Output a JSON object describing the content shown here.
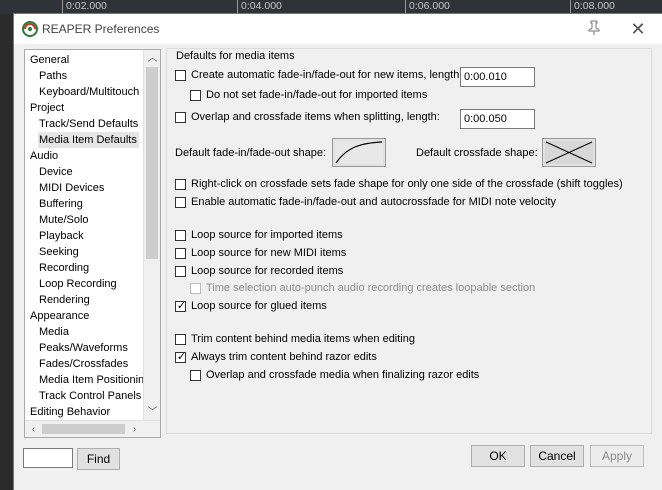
{
  "ruler": {
    "ticks": [
      "0:02.000",
      "0:04.000",
      "0:06.000",
      "0:08.000"
    ]
  },
  "window": {
    "title": "REAPER Preferences"
  },
  "tree": {
    "items": [
      {
        "label": "General",
        "level": 0
      },
      {
        "label": "Paths",
        "level": 1
      },
      {
        "label": "Keyboard/Multitouch",
        "level": 1
      },
      {
        "label": "Project",
        "level": 0
      },
      {
        "label": "Track/Send Defaults",
        "level": 1
      },
      {
        "label": "Media Item Defaults",
        "level": 1,
        "selected": true
      },
      {
        "label": "Audio",
        "level": 0
      },
      {
        "label": "Device",
        "level": 1
      },
      {
        "label": "MIDI Devices",
        "level": 1
      },
      {
        "label": "Buffering",
        "level": 1
      },
      {
        "label": "Mute/Solo",
        "level": 1
      },
      {
        "label": "Playback",
        "level": 1
      },
      {
        "label": "Seeking",
        "level": 1
      },
      {
        "label": "Recording",
        "level": 1
      },
      {
        "label": "Loop Recording",
        "level": 1
      },
      {
        "label": "Rendering",
        "level": 1
      },
      {
        "label": "Appearance",
        "level": 0
      },
      {
        "label": "Media",
        "level": 1
      },
      {
        "label": "Peaks/Waveforms",
        "level": 1
      },
      {
        "label": "Fades/Crossfades",
        "level": 1
      },
      {
        "label": "Media Item Positioning",
        "level": 1
      },
      {
        "label": "Track Control Panels",
        "level": 1
      },
      {
        "label": "Editing Behavior",
        "level": 0
      }
    ]
  },
  "group": {
    "title": "Defaults for media items"
  },
  "options": {
    "auto_fade": {
      "label": "Create automatic fade-in/fade-out for new items, length:",
      "checked": false,
      "value": "0:00.010"
    },
    "no_fade_imported": {
      "label": "Do not set fade-in/fade-out for imported items",
      "checked": false
    },
    "overlap_split": {
      "label": "Overlap and crossfade items when splitting, length:",
      "checked": false,
      "value": "0:00.050"
    },
    "fade_shape_label": "Default fade-in/fade-out shape:",
    "crossfade_shape_label": "Default crossfade shape:",
    "right_click_crossfade": {
      "label": "Right-click on crossfade sets fade shape for only one side of the crossfade (shift toggles)",
      "checked": false
    },
    "midi_velocity": {
      "label": "Enable automatic fade-in/fade-out and autocrossfade for MIDI note velocity",
      "checked": false
    },
    "loop_imported": {
      "label": "Loop source for imported items",
      "checked": false
    },
    "loop_midi": {
      "label": "Loop source for new MIDI items",
      "checked": false
    },
    "loop_recorded": {
      "label": "Loop source for recorded items",
      "checked": false
    },
    "time_selection_punch": {
      "label": "Time selection auto-punch audio recording creates loopable section",
      "checked": false,
      "disabled": true
    },
    "loop_glued": {
      "label": "Loop source for glued items",
      "checked": true
    },
    "trim_behind": {
      "label": "Trim content behind media items when editing",
      "checked": false
    },
    "always_trim_razor": {
      "label": "Always trim content behind razor edits",
      "checked": true
    },
    "overlap_razor": {
      "label": "Overlap and crossfade media when finalizing razor edits",
      "checked": false
    }
  },
  "footer": {
    "find_value": "",
    "find_label": "Find",
    "ok_label": "OK",
    "cancel_label": "Cancel",
    "apply_label": "Apply"
  }
}
